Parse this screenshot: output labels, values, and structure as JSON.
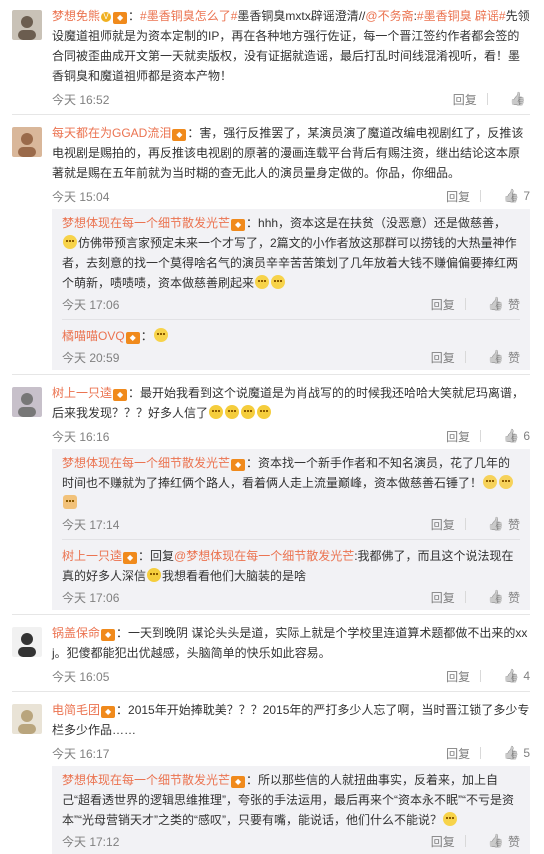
{
  "comments": [
    {
      "user": "梦想免熊",
      "segments": [
        {
          "k": "t",
          "v": "："
        },
        {
          "k": "l",
          "v": "#墨香铜臭怎么了#"
        },
        {
          "k": "t",
          "v": "墨香铜臭mxtx辟谣澄清//"
        },
        {
          "k": "l",
          "v": "@不务斋"
        },
        {
          "k": "t",
          "v": ":"
        },
        {
          "k": "l",
          "v": "#墨香铜臭 辟谣#"
        },
        {
          "k": "t",
          "v": "先领设魔道祖师就是为资本定制的IP，再在各种地方强行佐证，每一个晋江签约作者都会签的合同被歪曲成开文第一天就卖版权，没有证据就造谣，最后打乱时间线混淆视听，看！墨香铜臭和魔道祖师都是资本产物！"
        }
      ],
      "time": "今天 16:52",
      "reply": "回复",
      "likes": ""
    },
    {
      "user": "每天都在为GGAD流泪",
      "segments": [
        {
          "k": "t",
          "v": "：害，强行反推罢了，某演员演了魔道改编电视剧红了，反推该电视剧是赐拍的，再反推该电视剧的原著的漫画连载平台背后有赐注资，继出结论这本原著就是赐在五年前就为当时糊的查无此人的演员量身定做的。你品，你细品。"
        }
      ],
      "time": "今天 15:04",
      "reply": "回复",
      "likes": "7",
      "replies": [
        {
          "user": "梦想体现在每一个细节散发光芒",
          "segments": [
            {
              "k": "t",
              "v": "：hhh，资本这是在扶贫（没恶意）还是做慈善，"
            },
            {
              "k": "e",
              "v": "smile"
            },
            {
              "k": "t",
              "v": "仿佛带预言家预定未来一个才写了，2篇文的小作者放这那群可以捞钱的大热量神作者，去刻意的找一个莫得啥名气的演员辛辛苦苦策划了几年放着大钱不赚偏偏要捧红两个萌新，啧啧啧，资本做慈善刷起来"
            },
            {
              "k": "e",
              "v": "smile"
            },
            {
              "k": "e",
              "v": "smile"
            }
          ],
          "time": "今天 17:06",
          "reply": "回复",
          "likes": "赞"
        },
        {
          "user": "橘喵喵OVQ",
          "segments": [
            {
              "k": "t",
              "v": "："
            },
            {
              "k": "e",
              "v": "smile"
            }
          ],
          "time": "今天 20:59",
          "reply": "回复",
          "likes": "赞"
        }
      ]
    },
    {
      "user": "树上一只逵",
      "segments": [
        {
          "k": "t",
          "v": "：最开始我看到这个说魔道是为肖战写的的时候我还哈哈大笑就尼玛离谱，后来我发现？？？好多人信了"
        },
        {
          "k": "e",
          "v": "sweat"
        },
        {
          "k": "e",
          "v": "sweat"
        },
        {
          "k": "e",
          "v": "sweat"
        },
        {
          "k": "e",
          "v": "sweat"
        }
      ],
      "time": "今天 16:16",
      "reply": "回复",
      "likes": "6",
      "replies": [
        {
          "user": "梦想体现在每一个细节散发光芒",
          "segments": [
            {
              "k": "t",
              "v": "：资本找一个新手作者和不知名演员，花了几年的时间也不赚就为了捧红俩个路人，看着俩人走上流量巅峰，资本做慈善石锤了！"
            },
            {
              "k": "e",
              "v": "cry"
            },
            {
              "k": "e",
              "v": "cry"
            },
            {
              "k": "e",
              "v": "thumbs"
            }
          ],
          "time": "今天 17:14",
          "reply": "回复",
          "likes": "赞"
        },
        {
          "user": "树上一只逵",
          "segments": [
            {
              "k": "t",
              "v": "：回复"
            },
            {
              "k": "l",
              "v": "@梦想体现在每一个细节散发光芒"
            },
            {
              "k": "t",
              "v": ":我都佛了，而且这个说法现在真的好多人深信"
            },
            {
              "k": "e",
              "v": "sweat"
            },
            {
              "k": "t",
              "v": "我想看看他们大脑装的是啥"
            }
          ],
          "time": "今天 17:06",
          "reply": "回复",
          "likes": "赞"
        }
      ]
    },
    {
      "user": "锅盖保命",
      "segments": [
        {
          "k": "t",
          "v": "：一天到晚阴 谋论头头是道，实际上就是个学校里连道算术题都做不出来的xxj。犯傻都能犯出优越感，头脑简单的快乐如此容易。"
        }
      ],
      "time": "今天 16:05",
      "reply": "回复",
      "likes": "4"
    },
    {
      "user": "电简毛团",
      "segments": [
        {
          "k": "t",
          "v": "：2015年开始捧耽美？？？2015年的严打多少人忘了啊，当时晋江锁了多少专栏多少作品……"
        }
      ],
      "time": "今天 16:17",
      "reply": "回复",
      "likes": "5",
      "replies": [
        {
          "user": "梦想体现在每一个细节散发光芒",
          "segments": [
            {
              "k": "t",
              "v": "：所以那些信的人就扭曲事实，反着来，加上自己“超看透世界的逻辑思维推理”，夸张的手法运用，最后再来个“资本永不眠”“不亏是资本”“光母营销天才”之类的“感叹”，只要有嘴，能说话，他们什么不能说？"
            },
            {
              "k": "e",
              "v": "smile"
            }
          ],
          "time": "今天 17:12",
          "reply": "回复",
          "likes": "赞"
        }
      ]
    }
  ],
  "colors": {
    "username": "#eb7350",
    "meta": "#808080",
    "reply_bg": "#f2f2f5"
  }
}
